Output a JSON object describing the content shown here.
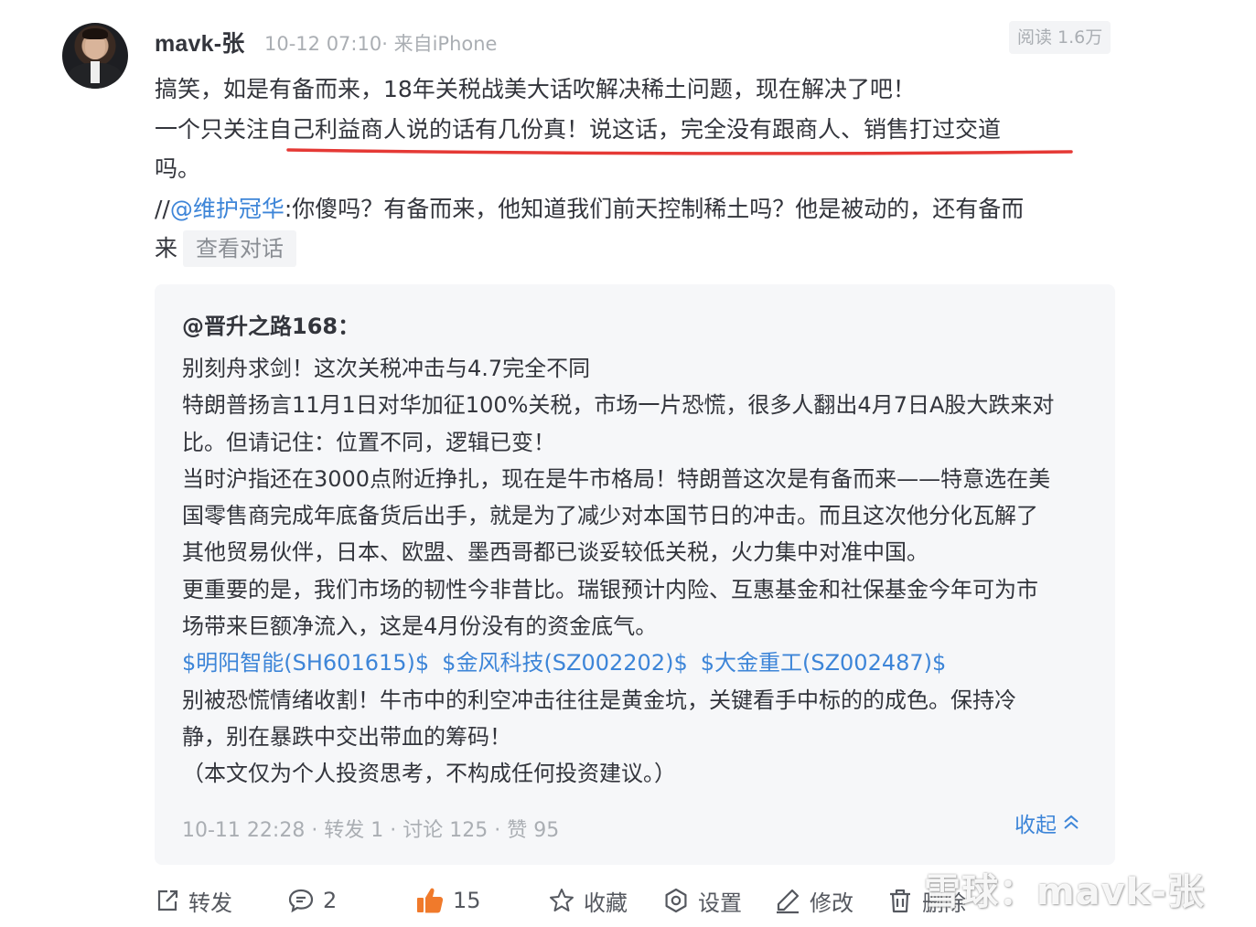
{
  "header": {
    "username": "mavk-张",
    "meta": "10-12 07:10· 来自iPhone",
    "read_count": "阅读 1.6万"
  },
  "post": {
    "line1": "搞笑，如是有备而来，18年关税战美大话吹解决稀土问题，现在解决了吧！",
    "line2": "一个只关注自己利益商人说的话有几份真！说这话，完全没有跟商人、销售打过交道",
    "line3": "吗。",
    "repost_prefix": "//",
    "mention": "@维护冠华",
    "repost_text": ":你傻吗？有备而来，他知道我们前天控制稀土吗？他是被动的，还有备而",
    "repost_text_2": "来",
    "view_conversation": "查看对话"
  },
  "quote": {
    "author": "@晋升之路168",
    "author_suffix": "：",
    "lines": [
      "别刻舟求剑！这次关税冲击与4.7完全不同",
      "特朗普扬言11月1日对华加征100%关税，市场一片恐慌，很多人翻出4月7日A股大跌来对",
      "比。但请记住：位置不同，逻辑已变！",
      "当时沪指还在3000点附近挣扎，现在是牛市格局！特朗普这次是有备而来——特意选在美",
      "国零售商完成年底备货后出手，就是为了减少对本国节日的冲击。而且这次他分化瓦解了",
      "其他贸易伙伴，日本、欧盟、墨西哥都已谈妥较低关税，火力集中对准中国。",
      "更重要的是，我们市场的韧性今非昔比。瑞银预计内险、互惠基金和社保基金今年可为市",
      "场带来巨额净流入，这是4月份没有的资金底气。"
    ],
    "stocks": [
      "$明阳智能(SH601615)$",
      "$金风科技(SZ002202)$",
      "$大金重工(SZ002487)$"
    ],
    "lines_after": [
      "别被恐慌情绪收割！牛市中的利空冲击往往是黄金坑，关键看手中标的的成色。保持冷",
      "静，别在暴跌中交出带血的筹码！",
      "（本文仅为个人投资思考，不构成任何投资建议。）"
    ],
    "footer": "10-11 22:28   · 转发 1 · 讨论 125 · 赞 95",
    "collapse_label": "收起"
  },
  "actions": {
    "repost": "转发",
    "comment_count": "2",
    "like_count": "15",
    "favorite": "收藏",
    "settings": "设置",
    "edit": "修改",
    "delete": "删除"
  },
  "watermark": "雪球：mavk-张",
  "colors": {
    "accent_blue": "#3d85d8",
    "underline_red": "#e53935",
    "like_orange": "#f07a2b",
    "text_main": "#33353c",
    "text_muted": "#aaaeb3"
  }
}
